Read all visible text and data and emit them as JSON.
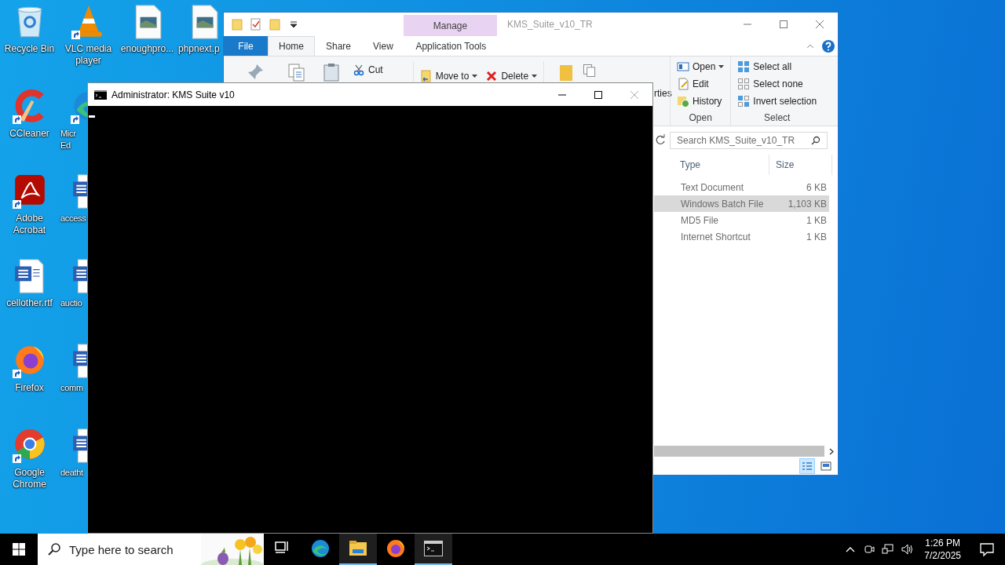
{
  "desktop_columns": [
    [
      {
        "kind": "recycle-bin",
        "label": "Recycle Bin",
        "shortcut": false
      },
      {
        "kind": "ccleaner",
        "label": "CCleaner",
        "shortcut": true
      },
      {
        "kind": "acrobat",
        "label": "Adobe\nAcrobat",
        "shortcut": true
      },
      {
        "kind": "word-file",
        "label": "cellother.rtf",
        "shortcut": false
      },
      {
        "kind": "firefox",
        "label": "Firefox",
        "shortcut": true
      },
      {
        "kind": "chrome",
        "label": "Google\nChrome",
        "shortcut": true
      }
    ],
    [
      {
        "kind": "vlc",
        "label": "VLC media\nplayer",
        "shortcut": true
      },
      {
        "kind": "edge",
        "label": "Micr\nEd",
        "shortcut": true
      },
      {
        "kind": "word-file",
        "label": "access",
        "shortcut": false
      },
      {
        "kind": "word-file",
        "label": "auctio",
        "shortcut": false
      },
      {
        "kind": "word-file",
        "label": "comm",
        "shortcut": false
      },
      {
        "kind": "word-file",
        "label": "deatht",
        "shortcut": false
      }
    ],
    [
      {
        "kind": "image-file",
        "label": "enoughpro...",
        "shortcut": false
      }
    ],
    [
      {
        "kind": "image-file",
        "label": "phpnext.p",
        "shortcut": false
      }
    ]
  ],
  "explorer": {
    "title": "KMS_Suite_v10_TR",
    "context_tab": "Manage",
    "tabs": [
      {
        "label": "File",
        "kind": "file",
        "selected": false
      },
      {
        "label": "Home",
        "kind": "plain",
        "selected": true
      },
      {
        "label": "Share",
        "kind": "plain",
        "selected": false
      },
      {
        "label": "View",
        "kind": "plain",
        "selected": false
      },
      {
        "label": "Application Tools",
        "kind": "context",
        "selected": false
      }
    ],
    "clipboard_items": [
      {
        "label": "Cut",
        "kind": "scissors",
        "caret": false
      }
    ],
    "organize_items": [
      {
        "label": "Move to",
        "kind": "move",
        "caret": true
      },
      {
        "label": "Delete",
        "kind": "delete",
        "caret": true
      }
    ],
    "properties_label": "rties",
    "open_group": {
      "label": "Open",
      "items": [
        {
          "label": "Open",
          "kind": "open",
          "caret": true
        },
        {
          "label": "Edit",
          "kind": "edit",
          "caret": false
        },
        {
          "label": "History",
          "kind": "history",
          "caret": false
        }
      ]
    },
    "select_group": {
      "label": "Select",
      "items": [
        {
          "label": "Select all",
          "kind": "select-all",
          "caret": false
        },
        {
          "label": "Select none",
          "kind": "select-none",
          "caret": false
        },
        {
          "label": "Invert selection",
          "kind": "invert",
          "caret": false
        }
      ]
    },
    "search": {
      "placeholder": "Search KMS_Suite_v10_TR"
    },
    "columns": [
      "Type",
      "Size"
    ],
    "rows": [
      {
        "type": "Text Document",
        "size": "6 KB",
        "selected": false
      },
      {
        "type": "Windows Batch File",
        "size": "1,103 KB",
        "selected": true
      },
      {
        "type": "MD5 File",
        "size": "1 KB",
        "selected": false
      },
      {
        "type": "Internet Shortcut",
        "size": "1 KB",
        "selected": false
      }
    ]
  },
  "console": {
    "title": "Administrator:  KMS Suite v10"
  },
  "taskbar": {
    "search": {
      "placeholder": "Type here to search"
    },
    "apps": [
      {
        "kind": "task-view",
        "active": false
      },
      {
        "kind": "edge",
        "active": false
      },
      {
        "kind": "explorer",
        "active": true
      },
      {
        "kind": "firefox",
        "active": false
      },
      {
        "kind": "terminal",
        "active": true
      }
    ],
    "time": "1:26 PM",
    "date": "7/2/2025"
  }
}
